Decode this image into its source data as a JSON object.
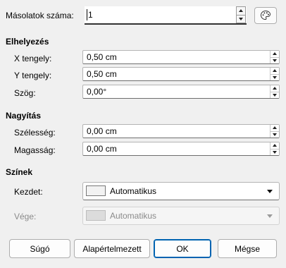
{
  "copies": {
    "label": "Másolatok száma:",
    "value": "1"
  },
  "placement": {
    "title": "Elhelyezés",
    "x_label": "X tengely:",
    "x_value": "0,50 cm",
    "y_label": "Y tengely:",
    "y_value": "0,50 cm",
    "angle_label": "Szög:",
    "angle_value": "0,00°"
  },
  "enlargement": {
    "title": "Nagyítás",
    "width_label": "Szélesség:",
    "width_value": "0,00 cm",
    "height_label": "Magasság:",
    "height_value": "0,00 cm"
  },
  "colors": {
    "title": "Színek",
    "start_label": "Kezdet:",
    "start_value": "Automatikus",
    "start_swatch": "#f2f2f2",
    "end_label": "Vége:",
    "end_value": "Automatikus",
    "end_swatch": "#dcdcdc"
  },
  "buttons": {
    "help": "Súgó",
    "reset": "Alapértelmezett",
    "ok": "OK",
    "cancel": "Mégse"
  },
  "icons": {
    "values_from_selection": "palette-icon"
  },
  "accent_color": "#0063b1"
}
